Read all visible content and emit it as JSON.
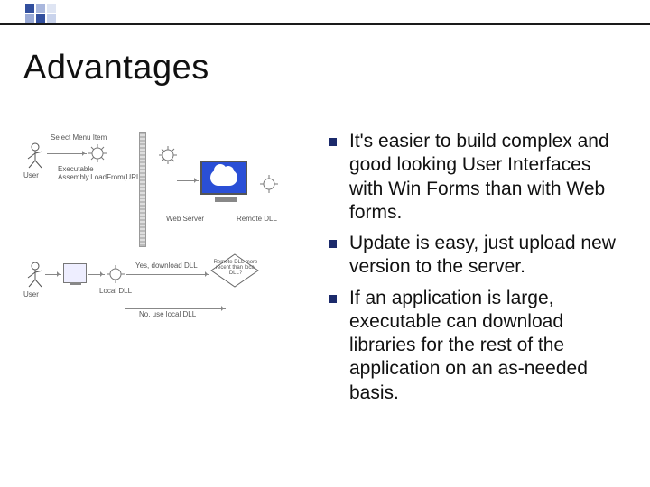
{
  "decor": {
    "sq_colors": [
      "#324f9e",
      "#a9b7dd",
      "#dfe5f3",
      "#9aaad6",
      "#324f9e",
      "#c9d3ec"
    ]
  },
  "title": "Advantages",
  "diagram": {
    "labels": {
      "user_top": "User",
      "select_menu": "Select Menu Item",
      "exec_load": "Executable Assembly.LoadFrom(URL)",
      "web_server": "Web Server",
      "remote_dll": "Remote DLL",
      "user_bottom": "User",
      "local_dll": "Local DLL",
      "decision": "Remote DLL more recent than local DLL?",
      "yes": "Yes, download DLL",
      "no": "No, use local DLL"
    }
  },
  "bullets": [
    "It's easier to build complex and good looking User Interfaces with Win Forms than with Web forms.",
    "Update is easy, just upload new version to the server.",
    "If an application is large, executable can download libraries for the rest of the application on an as-needed basis."
  ]
}
